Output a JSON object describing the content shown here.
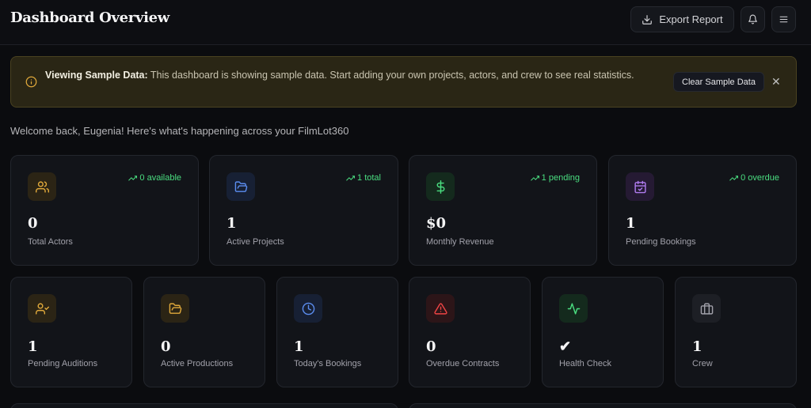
{
  "header": {
    "title": "Dashboard Overview",
    "export_label": "Export Report"
  },
  "banner": {
    "title": "Viewing Sample Data:",
    "message": " This dashboard is showing sample data. Start adding your own projects, actors, and crew to see real statistics.",
    "clear_label": "Clear Sample Data",
    "close_glyph": "✕"
  },
  "welcome": "Welcome back, Eugenia! Here's what's happening across your FilmLot360",
  "stats_top": [
    {
      "icon": "users-icon",
      "value": "0",
      "label": "Total Actors",
      "trend": "0 available",
      "color": "#e0a93b"
    },
    {
      "icon": "folder-icon",
      "value": "1",
      "label": "Active Projects",
      "trend": "1 total",
      "color": "#5b8def"
    },
    {
      "icon": "dollar-icon",
      "value": "$0",
      "label": "Monthly Revenue",
      "trend": "1 pending",
      "color": "#4ade80"
    },
    {
      "icon": "calendar-check-icon",
      "value": "1",
      "label": "Pending Bookings",
      "trend": "0 overdue",
      "color": "#b07cf0"
    }
  ],
  "stats_bottom": [
    {
      "icon": "user-check-icon",
      "value": "1",
      "label": "Pending Auditions",
      "color": "#e0a93b"
    },
    {
      "icon": "folder-open-icon",
      "value": "0",
      "label": "Active Productions",
      "color": "#e0a93b"
    },
    {
      "icon": "clock-icon",
      "value": "1",
      "label": "Today's Bookings",
      "color": "#5b8def"
    },
    {
      "icon": "alert-triangle-icon",
      "value": "0",
      "label": "Overdue Contracts",
      "color": "#ef4444"
    },
    {
      "icon": "activity-icon",
      "value": "✔",
      "label": "Health Check",
      "color": "#4ade80"
    },
    {
      "icon": "briefcase-icon",
      "value": "1",
      "label": "Crew",
      "color": "#a1a1aa"
    }
  ]
}
